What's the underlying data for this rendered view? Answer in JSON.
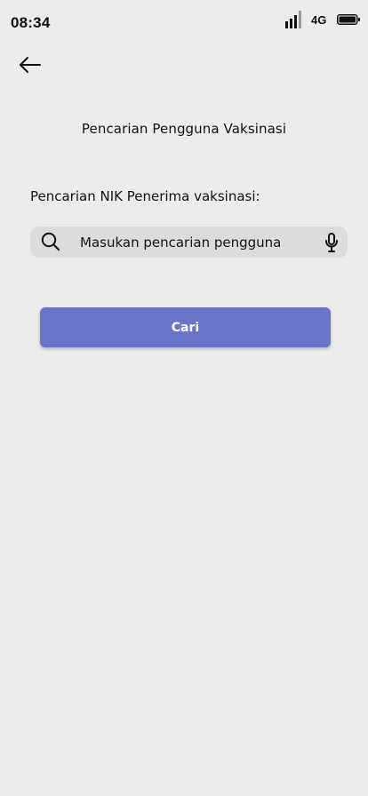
{
  "status_bar": {
    "time": "08:34",
    "network": "4G",
    "icons": [
      "signal-icon",
      "battery-icon"
    ]
  },
  "header": {
    "back_icon": "arrow-left-icon",
    "title": "Pencarian Pengguna Vaksinasi"
  },
  "search": {
    "label": "Pencarian NIK Penerima vaksinasi:",
    "placeholder": "Masukan pencarian pengguna",
    "value": "",
    "leading_icon": "search-icon",
    "trailing_icon": "microphone-icon"
  },
  "actions": {
    "submit_label": "Cari"
  },
  "colors": {
    "background": "#ececec",
    "search_field": "#dcdcdc",
    "primary": "#6a74c9",
    "text": "#111111"
  }
}
